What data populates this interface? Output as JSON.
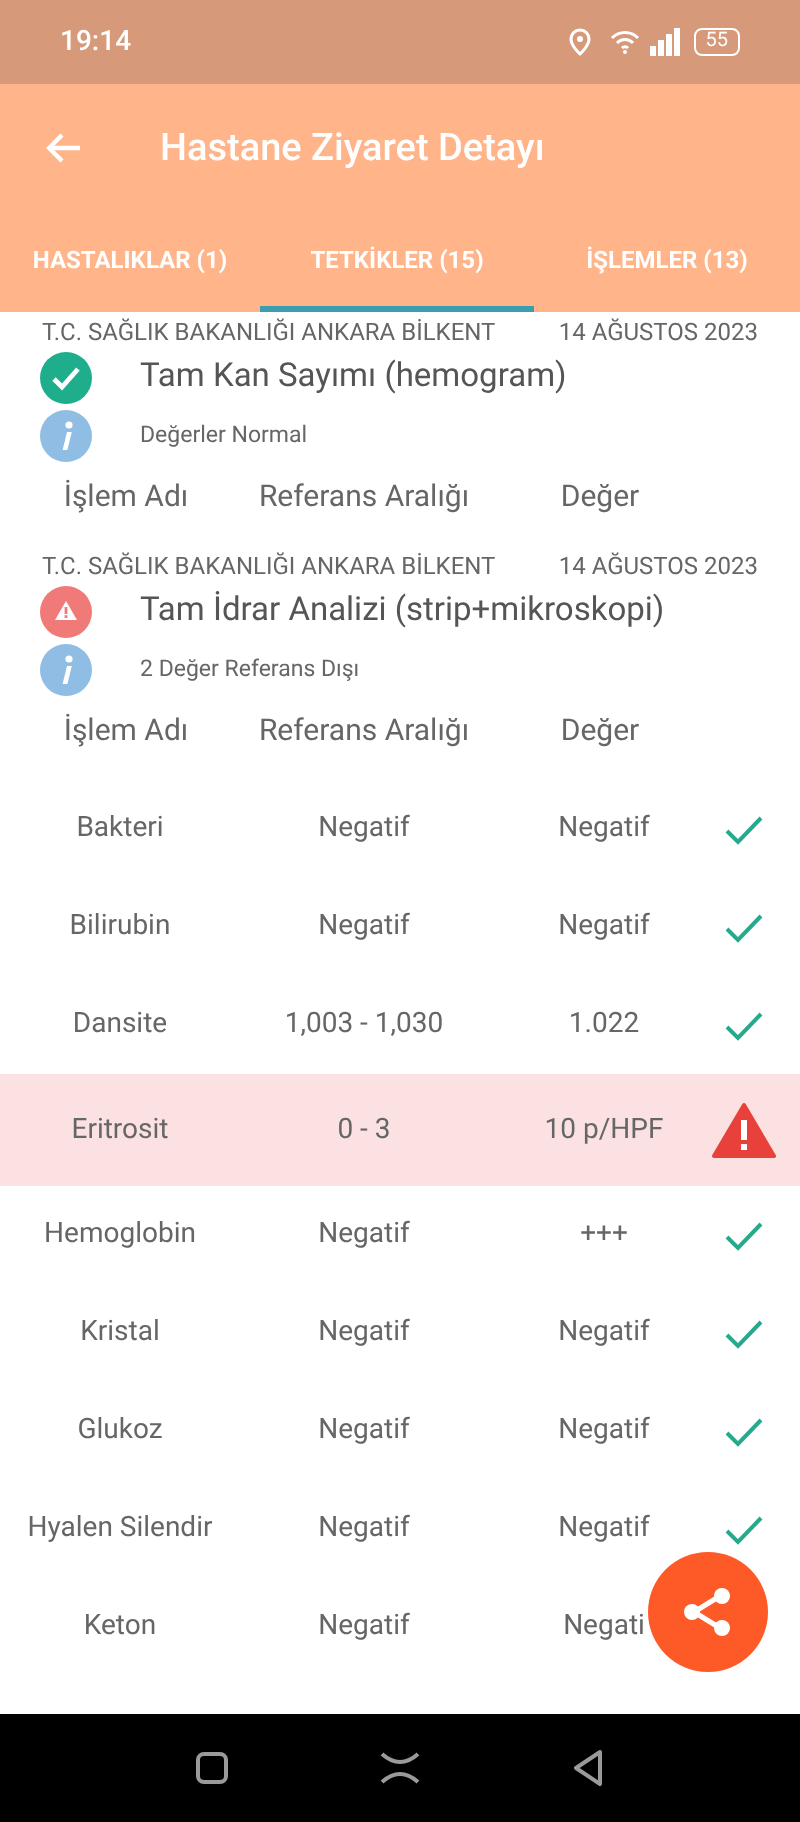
{
  "status_bar": {
    "time": "19:14",
    "battery": "55"
  },
  "app_bar": {
    "title": "Hastane Ziyaret Detayı"
  },
  "tabs": [
    {
      "label": "HASTALIKLAR (1)",
      "selected": false
    },
    {
      "label": "TETKİKLER (15)",
      "selected": true
    },
    {
      "label": "İŞLEMLER (13)",
      "selected": false
    }
  ],
  "tests": [
    {
      "hospital": "T.C. SAĞLIK BAKANLIĞI ANKARA BİLKENT",
      "date": "14 AĞUSTOS 2023",
      "name": "Tam Kan Sayımı (hemogram)",
      "out_of_range": false,
      "summary": "Değerler Normal",
      "columns": [
        "İşlem Adı",
        "Referans Aralığı",
        "Değer"
      ]
    },
    {
      "hospital": "T.C. SAĞLIK BAKANLIĞI ANKARA BİLKENT",
      "date": "14 AĞUSTOS 2023",
      "name": "Tam İdrar Analizi (strip+mikroskopi)",
      "out_of_range": true,
      "summary": "2 Değer Referans Dışı",
      "columns": [
        "İşlem Adı",
        "Referans Aralığı",
        "Değer"
      ],
      "rows": [
        {
          "name": "Bakteri",
          "reference": "Negatif",
          "value": "Negatif",
          "out_of_range": false
        },
        {
          "name": "Bilirubin",
          "reference": "Negatif",
          "value": "Negatif",
          "out_of_range": false
        },
        {
          "name": "Dansite",
          "reference": "1,003 - 1,030",
          "value": "1.022",
          "out_of_range": false
        },
        {
          "name": "Eritrosit",
          "reference": "0 - 3",
          "value": "10 p/HPF",
          "out_of_range": true
        },
        {
          "name": "Hemoglobin",
          "reference": "Negatif",
          "value": "+++",
          "out_of_range": false
        },
        {
          "name": "Kristal",
          "reference": "Negatif",
          "value": "Negatif",
          "out_of_range": false
        },
        {
          "name": "Glukoz",
          "reference": "Negatif",
          "value": "Negatif",
          "out_of_range": false
        },
        {
          "name": "Hyalen Silendir",
          "reference": "Negatif",
          "value": "Negatif",
          "out_of_range": false
        },
        {
          "name": "Keton",
          "reference": "Negatif",
          "value": "Negati"
        }
      ]
    }
  ]
}
